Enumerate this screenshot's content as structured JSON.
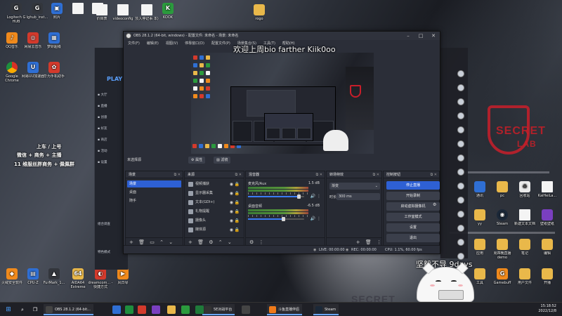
{
  "desktop_icons_top": [
    {
      "id": "logitech",
      "label": "Logitech G HUB",
      "glyph": "G",
      "cls": "g-dark"
    },
    {
      "id": "lghub",
      "label": "lghub_inst...",
      "glyph": "G",
      "cls": "g-dark"
    },
    {
      "id": "photos",
      "label": "照片",
      "glyph": "▣",
      "cls": "g-blue"
    },
    {
      "id": "file1",
      "label": "",
      "glyph": "",
      "cls": "g-doc"
    },
    {
      "id": "file2",
      "label": "",
      "glyph": "",
      "cls": "g-doc"
    },
    {
      "id": "photo-folder",
      "label": "",
      "glyph": "",
      "cls": "g-folder"
    },
    {
      "id": "file3",
      "label": "",
      "glyph": "",
      "cls": "g-doc"
    },
    {
      "id": "notes",
      "label": "价目表",
      "glyph": "",
      "cls": "g-doc"
    },
    {
      "id": "videoconfig",
      "label": "videoconfig",
      "glyph": "",
      "cls": "g-doc"
    },
    {
      "id": "record",
      "label": "顶入停记事 本)",
      "glyph": "",
      "cls": "g-doc"
    },
    {
      "id": "kook",
      "label": "KOOK",
      "glyph": "K",
      "cls": "g-green"
    },
    {
      "id": "rogo",
      "label": "rogo",
      "glyph": "",
      "cls": "g-folder"
    }
  ],
  "desktop_icons_left": [
    {
      "id": "qq-music",
      "label": "QQ音乐",
      "glyph": "♪",
      "cls": "g-orange"
    },
    {
      "id": "netease",
      "label": "网易云音乐",
      "glyph": "◎",
      "cls": "g-red"
    },
    {
      "id": "mengxiang",
      "label": "梦妍超级",
      "glyph": "▦",
      "cls": "g-blue"
    },
    {
      "id": "chrome",
      "label": "Google Chrome",
      "glyph": "",
      "cls": "g-chrome"
    },
    {
      "id": "netease-uu",
      "label": "网易UU加速器",
      "glyph": "U",
      "cls": "g-blue"
    },
    {
      "id": "huawei",
      "label": "华为手机助手",
      "glyph": "✿",
      "cls": "g-red"
    }
  ],
  "desktop_icons_bottom": [
    {
      "id": "security",
      "label": "火绒安全软件",
      "glyph": "◆",
      "cls": "g-orange"
    },
    {
      "id": "cpuz",
      "label": "CPU-Z",
      "glyph": "▤",
      "cls": "g-blue"
    },
    {
      "id": "furmark",
      "label": "FurMark_1...",
      "glyph": "▲",
      "cls": "g-dark"
    },
    {
      "id": "aida",
      "label": "AIDA64 Extreme",
      "glyph": "64",
      "cls": "g-folder"
    },
    {
      "id": "dreamcom",
      "label": "dreamcom... - 快捷方式",
      "glyph": "◐",
      "cls": "g-red"
    },
    {
      "id": "kuaidi",
      "label": "风日琴",
      "glyph": "▶",
      "cls": "g-orange"
    }
  ],
  "desktop_icons_right": [
    {
      "id": "wallpaper1",
      "label": "通讯",
      "glyph": "",
      "cls": "g-blue"
    },
    {
      "id": "pc",
      "label": "pc",
      "glyph": "",
      "cls": "g-folder"
    },
    {
      "id": "recycle",
      "label": "回收站",
      "glyph": "♻",
      "cls": "g-white"
    },
    {
      "id": "kaiheila",
      "label": "KaiHeiLa...",
      "glyph": "",
      "cls": "g-doc"
    },
    {
      "id": "yy",
      "label": "yy",
      "glyph": "",
      "cls": "g-folder"
    },
    {
      "id": "steam",
      "label": "Steam",
      "glyph": "◉",
      "cls": "g-steam"
    },
    {
      "id": "newtext",
      "label": "新建文本文档",
      "glyph": "",
      "cls": "g-doc"
    },
    {
      "id": "wallpaper",
      "label": "壁纸壁纸",
      "glyph": "",
      "cls": "g-purple"
    },
    {
      "id": "apps",
      "label": "应用",
      "glyph": "",
      "cls": "g-folder"
    },
    {
      "id": "demo",
      "label": "周四晚直播 demo",
      "glyph": "",
      "cls": "g-folder"
    },
    {
      "id": "notepad",
      "label": "笔记",
      "glyph": "",
      "cls": "g-folder"
    },
    {
      "id": "edit",
      "label": "编辑",
      "glyph": "",
      "cls": "g-folder"
    },
    {
      "id": "tools",
      "label": "工具",
      "glyph": "",
      "cls": "g-folder"
    },
    {
      "id": "gamebuff",
      "label": "Gamebuff",
      "glyph": "G",
      "cls": "g-orange"
    },
    {
      "id": "user",
      "label": "用户文件",
      "glyph": "",
      "cls": "g-folder"
    },
    {
      "id": "open",
      "label": "开播",
      "glyph": "",
      "cls": "g-folder"
    }
  ],
  "promo": {
    "line1": "上车 / 上号",
    "line2": "微信 + 商务 + 主播",
    "line3": "11 维服丝胖商务 + 佩佩群"
  },
  "overlay": {
    "welcome": "欢迎上周bio farther Kiik0oo",
    "thanks": "坚毅不导 9days"
  },
  "bg_app": {
    "play": "PLAY",
    "items": [
      "大厅",
      "直播",
      "创意",
      "好友",
      "商店",
      "活动",
      "设置"
    ],
    "section1": "组合调查",
    "section2": "特色模式"
  },
  "obs": {
    "title": "OBS 28.1.2 (64-bit, windows) - 配置文件: 未命名 - 场景: 未命名",
    "menu": [
      "文件(F)",
      "编辑(E)",
      "视图(V)",
      "停靠窗口(D)",
      "配置文件(P)",
      "场景集合(S)",
      "工具(T)",
      "帮助(H)"
    ],
    "under_preview": {
      "no_source": "未选择源",
      "props": "属性",
      "filters": "滤镜"
    },
    "docks": {
      "scenes": {
        "title": "场景",
        "items": [
          "场景",
          "桌面",
          "随手"
        ],
        "selected": 0
      },
      "sources": {
        "title": "来源",
        "items": [
          {
            "label": "视频捕获",
            "icon": "camera-icon"
          },
          {
            "label": "显示器采集",
            "icon": "monitor-icon"
          },
          {
            "label": "文本(GDI+)",
            "icon": "text-icon"
          },
          {
            "label": "礼物提醒",
            "icon": "browser-icon"
          },
          {
            "label": "摄像头",
            "icon": "camera-icon"
          },
          {
            "label": "媒体源",
            "icon": "image-icon"
          }
        ]
      },
      "mixer": {
        "title": "混音器",
        "channels": [
          {
            "name": "麦克风/Aux",
            "db": "1.5 dB",
            "level": 0.9
          },
          {
            "name": "桌面音频",
            "db": "-6.5 dB",
            "level": 0.62
          }
        ]
      },
      "transitions": {
        "title": "转场特效",
        "type": "渐变",
        "duration_label": "时长",
        "duration": "300 ms"
      },
      "controls": {
        "title": "控制按钮",
        "buttons": [
          "停止直播",
          "开始录制",
          "启动虚拟摄像机",
          "工作室模式",
          "设置",
          "退出"
        ],
        "active": 0
      }
    },
    "status": {
      "live": "LIVE: 00:00:00",
      "rec": "REC: 00:00:00",
      "cpu": "CPU: 1.1%, 60.00 fps"
    }
  },
  "taskbar": {
    "tasks": [
      {
        "label": "OBS 28.1.2 (64-bit...",
        "color": "#444"
      },
      {
        "label": "5E对战平台",
        "color": "#333"
      },
      {
        "label": "斗鱼直播伴侣",
        "color": "#ef7a1a"
      },
      {
        "label": "Steam",
        "color": "#1b2838"
      }
    ],
    "time": "15:18:52",
    "date": "2022/12/8"
  }
}
